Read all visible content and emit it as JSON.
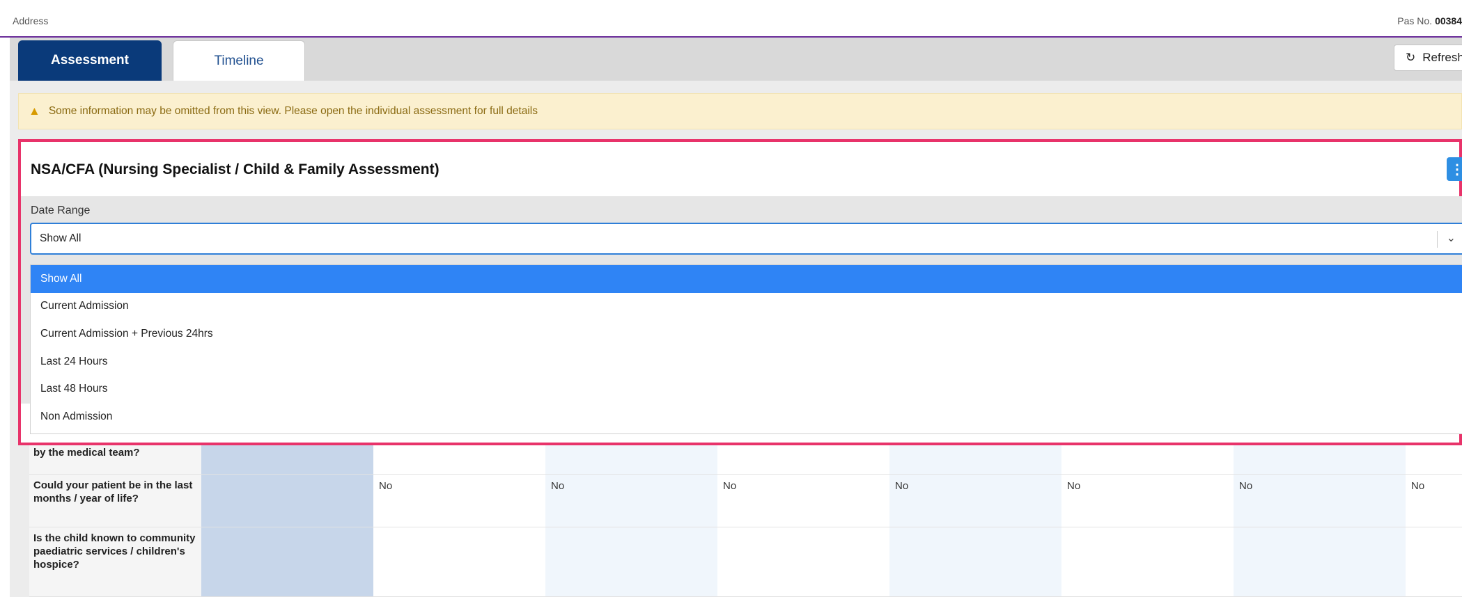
{
  "topbar": {
    "address_label": "Address",
    "pas_label": "Pas No.",
    "pas_value": "00384"
  },
  "tabs": {
    "assessment": "Assessment",
    "timeline": "Timeline"
  },
  "toolbar": {
    "refresh_label": "Refresh",
    "refresh_icon": "refresh-icon"
  },
  "alert": {
    "icon": "warning-icon",
    "text": "Some information may be omitted from this view. Please open the individual assessment for full details"
  },
  "panel": {
    "title": "NSA/CFA (Nursing Specialist / Child & Family Assessment)",
    "menu_icon": "kebab-menu-icon",
    "date_range_label": "Date Range",
    "date_range_value": "Show All",
    "options": [
      "Show All",
      "Current Admission",
      "Current Admission + Previous 24hrs",
      "Last 24 Hours",
      "Last 48 Hours",
      "Non Admission"
    ]
  },
  "table": {
    "rows": [
      {
        "label": "be in the last days / hours of life by the medical team?",
        "values": [
          "",
          "",
          "",
          "",
          "",
          "",
          ""
        ]
      },
      {
        "label": "Could your patient be in the last months / year of life?",
        "values": [
          "No",
          "No",
          "No",
          "No",
          "No",
          "No",
          "No"
        ]
      },
      {
        "label": "Is the child known to community paediatric services / children's hospice?",
        "values": [
          "",
          "",
          "",
          "",
          "",
          "",
          ""
        ]
      }
    ]
  },
  "colors": {
    "accent": "#0a3a7a",
    "highlight_border": "#e8336a",
    "selected_option": "#2f84f5",
    "alert_bg": "#fbf0cf"
  }
}
